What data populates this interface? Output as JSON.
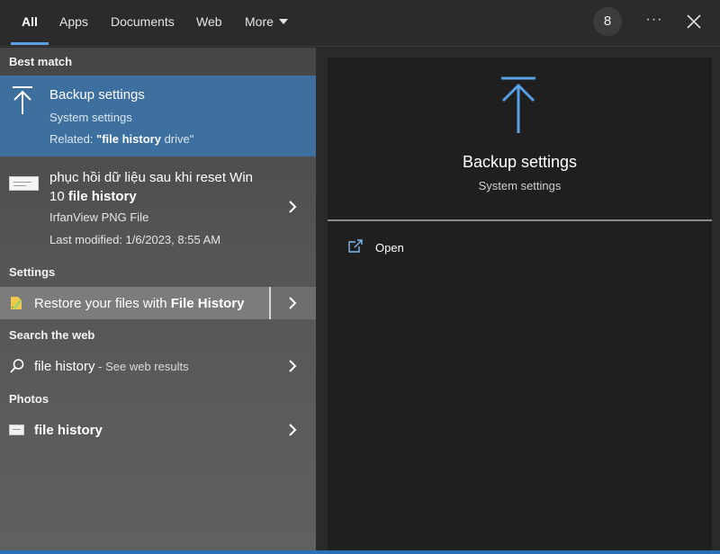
{
  "tabs": [
    {
      "label": "All",
      "active": true
    },
    {
      "label": "Apps"
    },
    {
      "label": "Documents"
    },
    {
      "label": "Web"
    },
    {
      "label": "More"
    }
  ],
  "topbar": {
    "badge": "8",
    "more_options": "···"
  },
  "sections": {
    "best_match": "Best match",
    "settings": "Settings",
    "search_web": "Search the web",
    "photos": "Photos"
  },
  "best_match": {
    "title": "Backup settings",
    "subtitle": "System settings",
    "related_prefix": "Related: ",
    "related_highlight": "\"file history",
    "related_suffix": " drive\"",
    "icon": "backup-arrow-icon"
  },
  "file_result": {
    "name_line1": "phục hồi dữ liệu sau khi reset Win",
    "name_line2_prefix": "10 ",
    "name_line2_bold": "file history",
    "type": "IrfanView PNG File",
    "modified": "Last modified: 1/6/2023, 8:55 AM"
  },
  "settings_result": {
    "label_prefix": "Restore your files with ",
    "label_bold": "File History",
    "icon": "file-history-icon"
  },
  "web_result": {
    "query": "file history",
    "suffix": " - See web results",
    "icon": "search-icon"
  },
  "photo_result": {
    "label": "file history",
    "icon": "photo-thumbnail"
  },
  "preview": {
    "title": "Backup settings",
    "subtitle": "System settings",
    "actions": [
      {
        "label": "Open",
        "icon": "open-icon"
      }
    ]
  },
  "colors": {
    "accent": "#5aa0e6",
    "selected_bg": "#3d6f9f",
    "preview_bg": "#1f1f1f"
  }
}
